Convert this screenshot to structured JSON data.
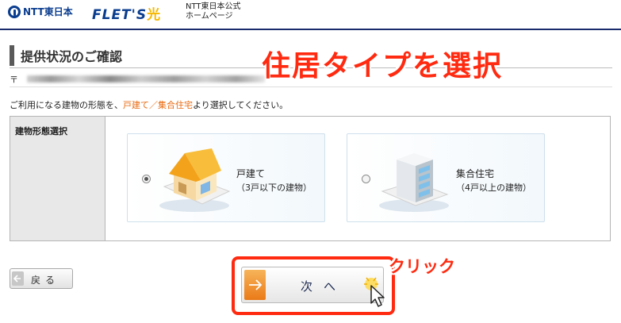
{
  "header": {
    "ntt_logo_text": "NTT東日本",
    "flets_logo_text": "FLET'S",
    "flets_logo_mark": "光",
    "homepage_line1": "NTT東日本公式",
    "homepage_line2": "ホームページ"
  },
  "page": {
    "title": "提供状況のご確認",
    "address_prefix": "〒",
    "instruction_before": "ご利用になる建物の形態を、",
    "instruction_highlight": "戸建て／集合住宅",
    "instruction_after": "より選択してください。"
  },
  "annotations": {
    "caption": "住居タイプを選択",
    "click_caption": "クリック"
  },
  "form": {
    "row_label": "建物形態選択",
    "options": [
      {
        "title": "戸建て",
        "subtitle": "（3戸以下の建物）",
        "icon": "house-icon",
        "selected": true
      },
      {
        "title": "集合住宅",
        "subtitle": "（4戸以上の建物）",
        "icon": "apartment-building-icon",
        "selected": false
      }
    ]
  },
  "buttons": {
    "back_label": "戻る",
    "next_label": "次へ"
  },
  "colors": {
    "brand_navy": "#1a2b6d",
    "annotation_red": "#ff2a10",
    "highlight_orange": "#e8690f",
    "next_orange": "#ea7a18"
  }
}
